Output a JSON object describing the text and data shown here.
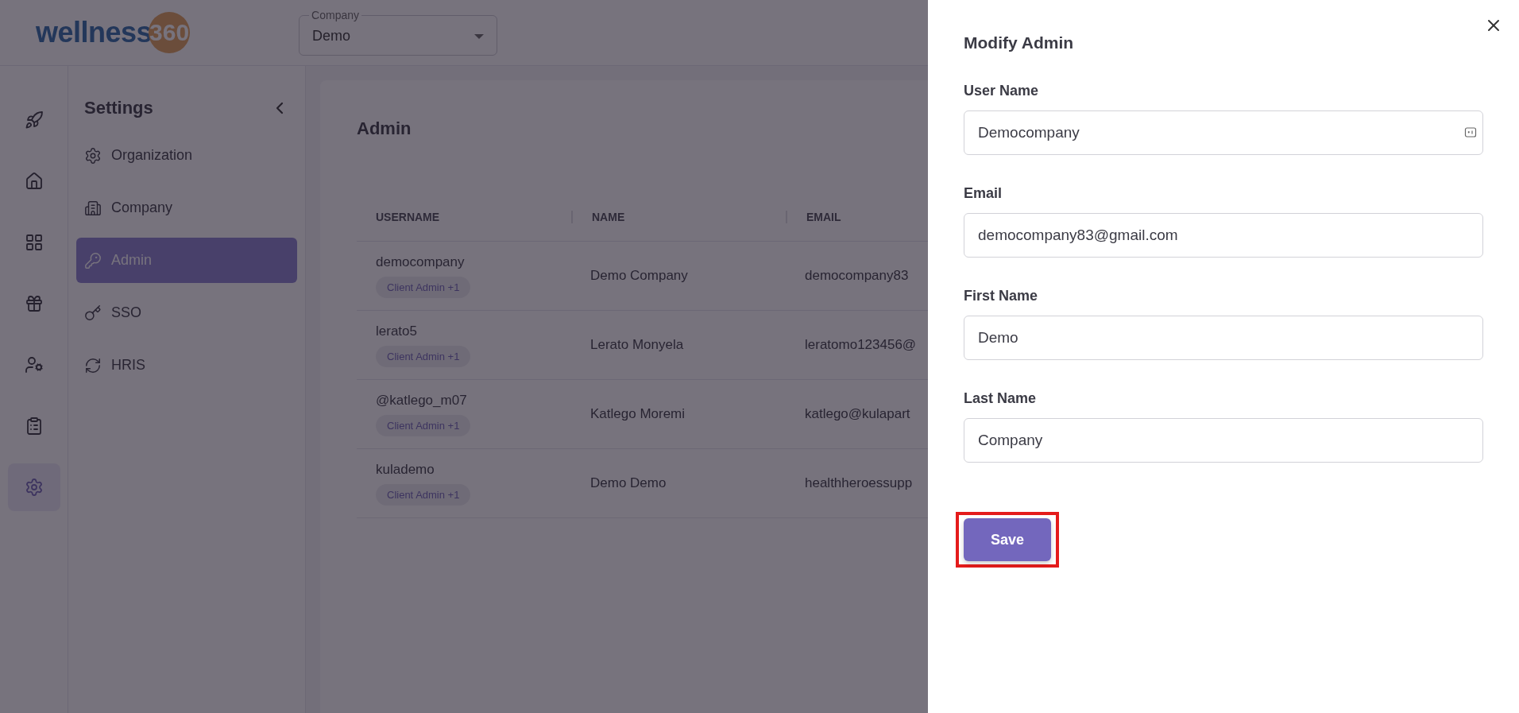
{
  "header": {
    "logo": {
      "word": "wellness",
      "number": "360"
    },
    "company_select": {
      "label": "Company",
      "value": "Demo"
    }
  },
  "rail": [
    {
      "selected": false
    },
    {
      "selected": false
    },
    {
      "selected": false
    },
    {
      "selected": false
    },
    {
      "selected": false
    },
    {
      "selected": false
    },
    {
      "selected": true
    }
  ],
  "settings": {
    "title": "Settings",
    "items": [
      {
        "label": "Organization",
        "selected": false
      },
      {
        "label": "Company",
        "selected": false
      },
      {
        "label": "Admin",
        "selected": true
      },
      {
        "label": "SSO",
        "selected": false
      },
      {
        "label": "HRIS",
        "selected": false
      }
    ]
  },
  "page": {
    "title": "Admin",
    "table": {
      "columns": [
        "USERNAME",
        "NAME",
        "EMAIL"
      ],
      "rows": [
        {
          "username": "democompany",
          "role": "Client Admin +1",
          "name": "Demo Company",
          "email": "democompany83"
        },
        {
          "username": "lerato5",
          "role": "Client Admin +1",
          "name": "Lerato Monyela",
          "email": "leratomo123456@"
        },
        {
          "username": "@katlego_m07",
          "role": "Client Admin +1",
          "name": "Katlego Moremi",
          "email": "katlego@kulapart"
        },
        {
          "username": "kulademo",
          "role": "Client Admin +1",
          "name": "Demo Demo",
          "email": "healthheroessupp"
        }
      ]
    }
  },
  "drawer": {
    "title": "Modify Admin",
    "fields": [
      {
        "label": "User Name",
        "value": "Democompany",
        "kind": "autofill"
      },
      {
        "label": "Email",
        "value": "democompany83@gmail.com",
        "kind": "plain"
      },
      {
        "label": "First Name",
        "value": "Demo",
        "kind": "plain"
      },
      {
        "label": "Last Name",
        "value": "Company",
        "kind": "plain"
      }
    ],
    "save_button": {
      "label": "Save",
      "highlighted": true
    }
  }
}
